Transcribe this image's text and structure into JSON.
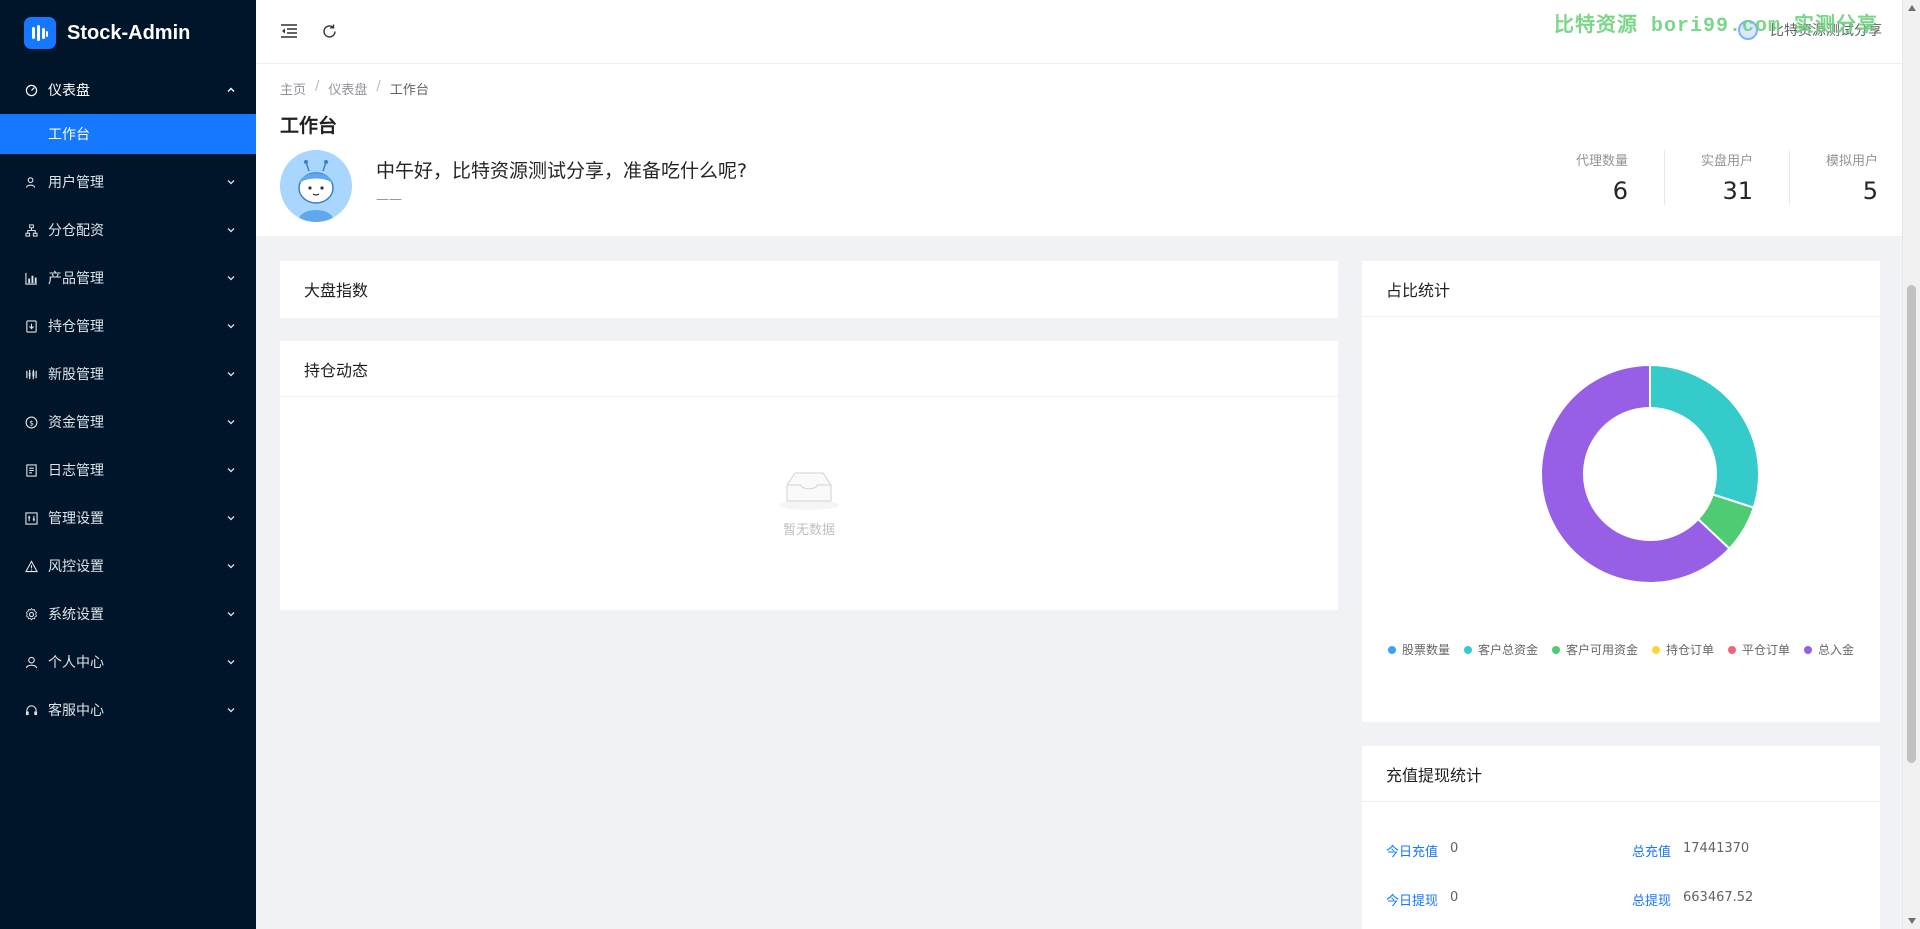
{
  "brand": {
    "title": "Stock-Admin",
    "logo_color": "#1677ff"
  },
  "sidebar": {
    "items": [
      {
        "label": "仪表盘",
        "icon": "dashboard-icon",
        "open": true
      },
      {
        "label": "用户管理",
        "icon": "user-icon"
      },
      {
        "label": "分仓配资",
        "icon": "cluster-icon"
      },
      {
        "label": "产品管理",
        "icon": "chart-icon"
      },
      {
        "label": "持仓管理",
        "icon": "inbox-icon"
      },
      {
        "label": "新股管理",
        "icon": "ipo-icon"
      },
      {
        "label": "资金管理",
        "icon": "money-icon"
      },
      {
        "label": "日志管理",
        "icon": "log-icon"
      },
      {
        "label": "管理设置",
        "icon": "setting-panel-icon"
      },
      {
        "label": "风控设置",
        "icon": "warning-icon"
      },
      {
        "label": "系统设置",
        "icon": "gear-icon"
      },
      {
        "label": "个人中心",
        "icon": "person-icon"
      },
      {
        "label": "客服中心",
        "icon": "headset-icon"
      }
    ],
    "active_sub": "工作台"
  },
  "header": {
    "watermark": "比特资源 bori99.com 实测分享",
    "username": "比特资源测试分享"
  },
  "breadcrumb": [
    "主页",
    "仪表盘",
    "工作台"
  ],
  "page": {
    "title": "工作台",
    "greeting": "中午好，比特资源测试分享，准备吃什么呢?",
    "greeting_sub": "——"
  },
  "stats": [
    {
      "label": "代理数量",
      "value": "6"
    },
    {
      "label": "实盘用户",
      "value": "31"
    },
    {
      "label": "模拟用户",
      "value": "5"
    }
  ],
  "cards": {
    "index_title": "大盘指数",
    "position_title": "持仓动态",
    "empty_text": "暂无数据",
    "ratio_title": "占比统计",
    "funds_title": "充值提现统计"
  },
  "chart_data": {
    "type": "pie",
    "title": "占比统计",
    "series": [
      {
        "name": "股票数量",
        "value": 0,
        "color": "#3ba1ff"
      },
      {
        "name": "客户总资金",
        "value": 30,
        "color": "#36cbcb"
      },
      {
        "name": "客户可用资金",
        "value": 7,
        "color": "#4ecb73"
      },
      {
        "name": "持仓订单",
        "value": 0,
        "color": "#fbd437"
      },
      {
        "name": "平仓订单",
        "value": 0,
        "color": "#f2637b"
      },
      {
        "name": "总入金",
        "value": 63,
        "color": "#975fe5"
      }
    ]
  },
  "funds": {
    "today_recharge_label": "今日充值",
    "today_recharge": "0",
    "total_recharge_label": "总充值",
    "total_recharge": "17441370",
    "today_withdraw_label": "今日提现",
    "today_withdraw": "0",
    "total_withdraw_label": "总提现",
    "total_withdraw": "663467.52"
  }
}
